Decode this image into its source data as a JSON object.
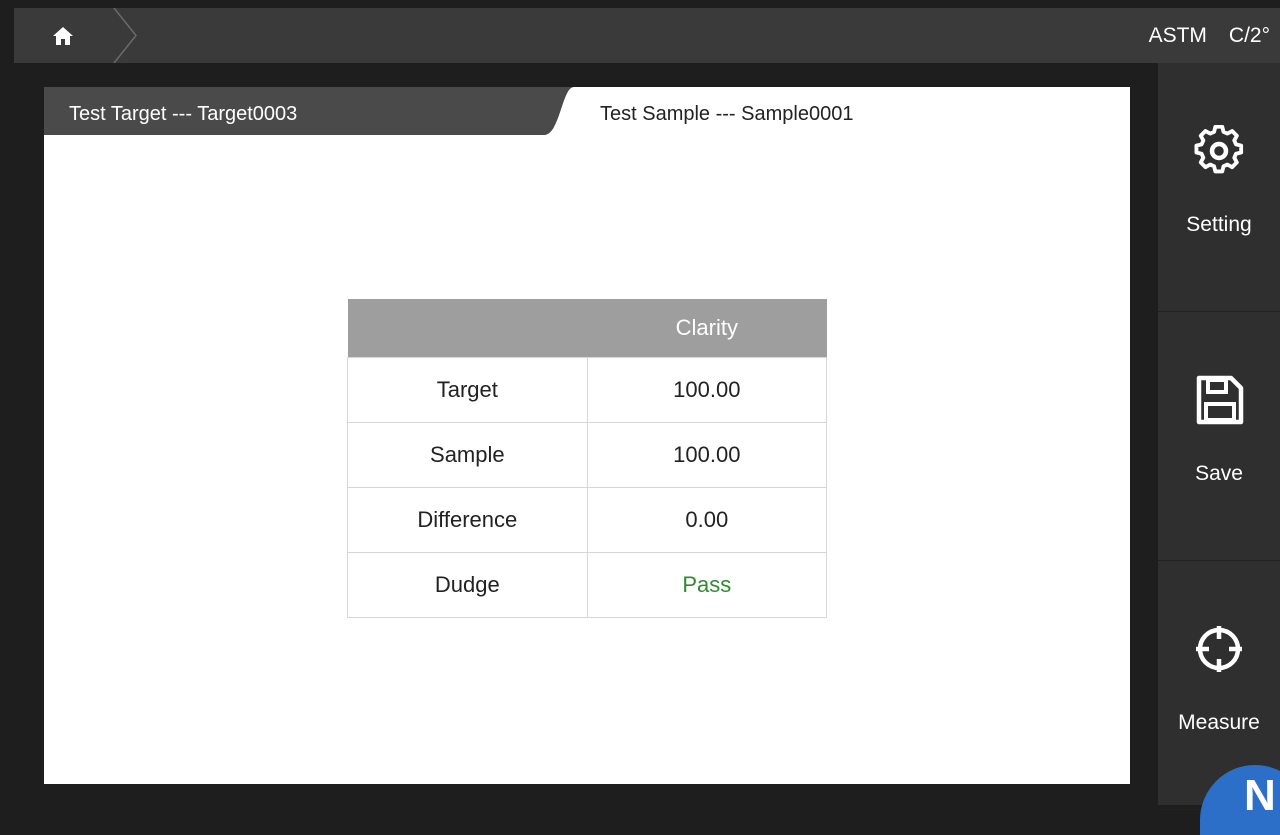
{
  "topbar": {
    "standard": "ASTM",
    "observer": "C/2°"
  },
  "tabs": {
    "target_label": "Test Target --- Target0003",
    "sample_label": "Test Sample --- Sample0001"
  },
  "table": {
    "header": [
      "",
      "Clarity"
    ],
    "rows": [
      {
        "label": "Target",
        "value": "100.00"
      },
      {
        "label": "Sample",
        "value": "100.00"
      },
      {
        "label": "Difference",
        "value": "0.00"
      },
      {
        "label": "Dudge",
        "value": "Pass"
      }
    ]
  },
  "sidebar": {
    "setting_label": "Setting",
    "save_label": "Save",
    "measure_label": "Measure"
  },
  "logo": {
    "text": "N"
  },
  "colors": {
    "pass": "#2e8b2e",
    "header_bg": "#9e9e9e",
    "brand": "#2b6fc8"
  }
}
